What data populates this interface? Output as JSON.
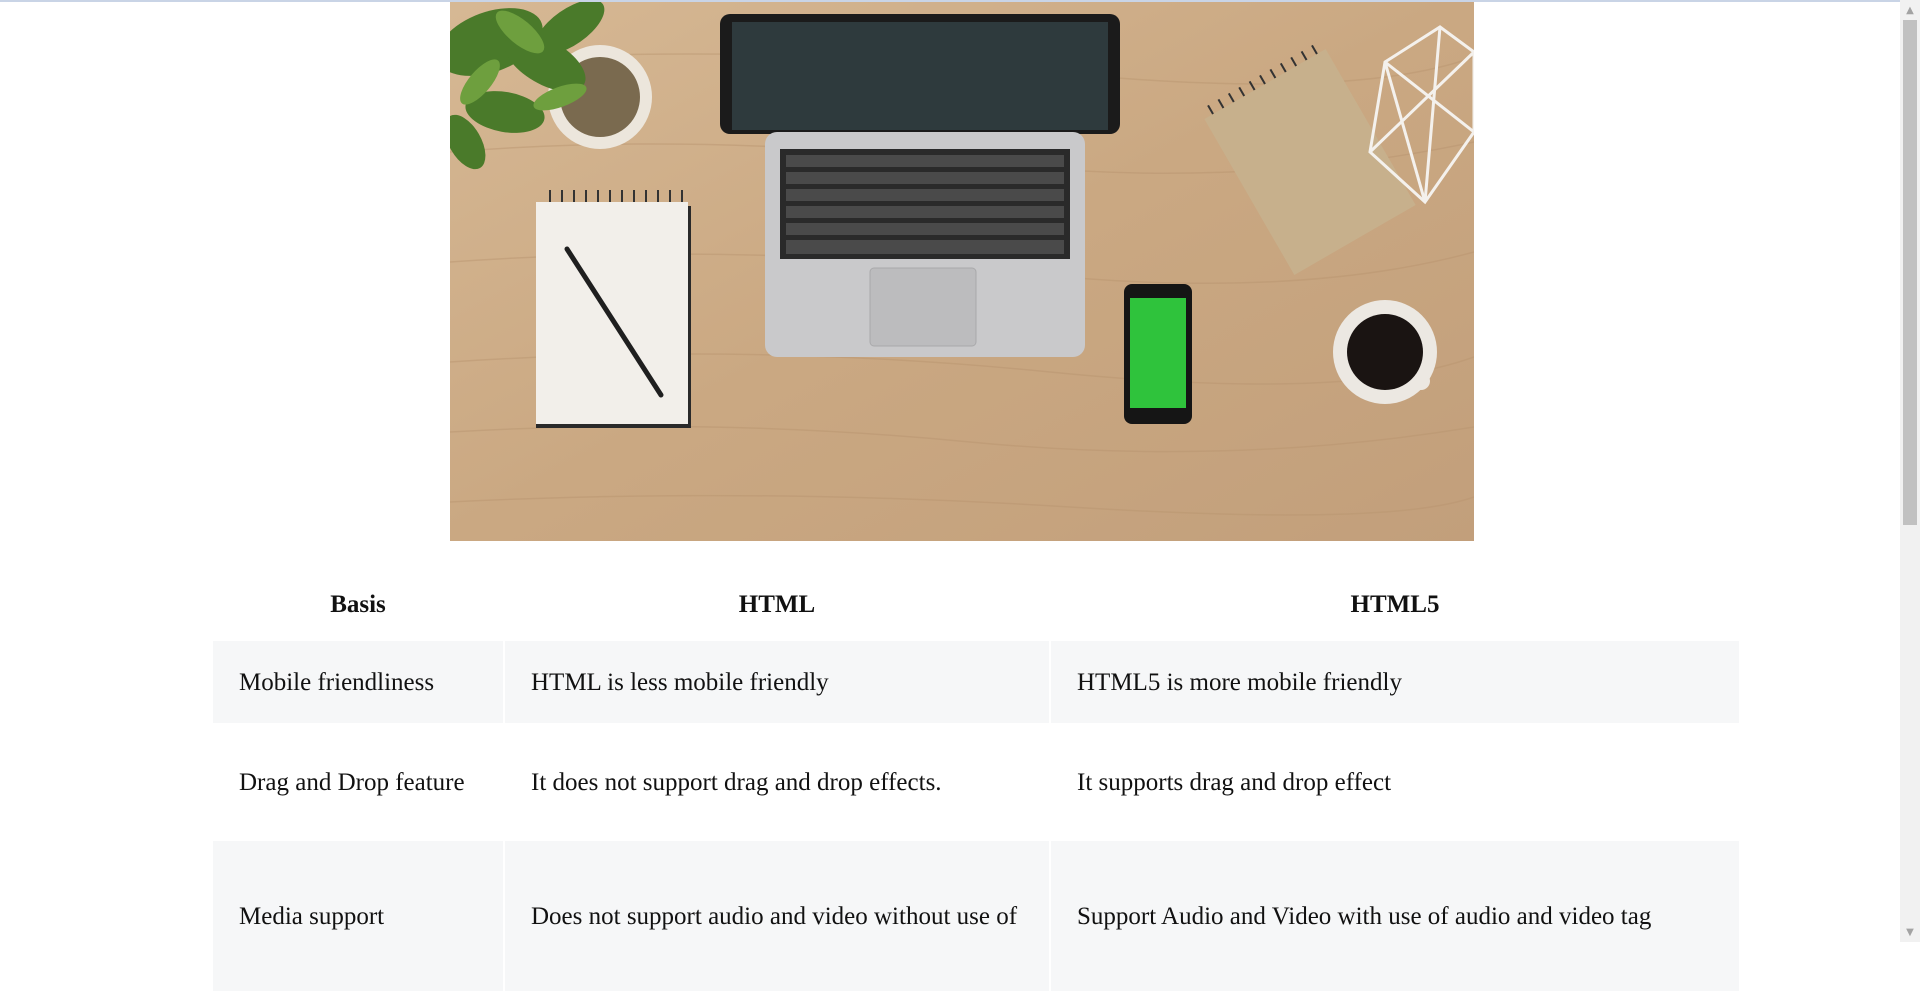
{
  "table": {
    "headers": [
      "Basis",
      "HTML",
      "HTML5"
    ],
    "rows": [
      [
        "Mobile friendliness",
        "HTML is less mobile friendly",
        "HTML5 is more mobile friendly"
      ],
      [
        "Drag and Drop feature",
        "It does not support drag and drop effects.",
        "It supports drag and drop effect"
      ],
      [
        "Media support",
        "Does not support audio and video without use of",
        "Support Audio and Video with use of audio and video tag"
      ]
    ]
  },
  "icons": {
    "scroll_up": "scroll-up-arrow-icon",
    "scroll_down": "scroll-down-arrow-icon"
  },
  "colors": {
    "row_alt_background": "#f6f7f8",
    "desk_wood": "#cdae8a",
    "phone_screen": "#2fc33c"
  }
}
